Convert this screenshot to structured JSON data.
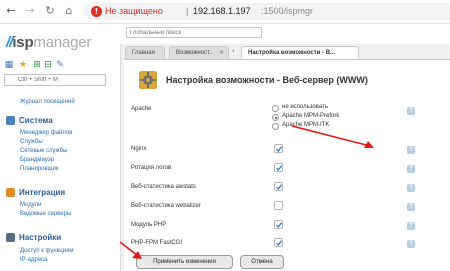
{
  "browser": {
    "insecure_label": "Не защищено",
    "url_separator": "|",
    "url_host": "192.168.1.197",
    "url_path": ":1500/ispmgr"
  },
  "header": {
    "logo_mark": "//",
    "logo_isp": "isp",
    "logo_manager": "manager",
    "global_search_placeholder": "Глобальный поиск"
  },
  "sidebar": {
    "menu_search_placeholder": "Ctrl + Shift + M",
    "top_items": [
      {
        "label": "Журнал посещений"
      }
    ],
    "sections": [
      {
        "title": "Система",
        "items": [
          {
            "label": "Менеджер файлов"
          },
          {
            "label": "Службы"
          },
          {
            "label": "Сетевые службы"
          },
          {
            "label": "Брандмауэр"
          },
          {
            "label": "Планировщик"
          }
        ]
      },
      {
        "title": "Интеграция",
        "items": [
          {
            "label": "Модули"
          },
          {
            "label": "Ведомые серверы"
          }
        ]
      },
      {
        "title": "Настройки",
        "items": [
          {
            "label": "Доступ к функциям"
          },
          {
            "label": "IP-адреса"
          }
        ]
      }
    ]
  },
  "tabs": [
    {
      "label": "Главная"
    },
    {
      "label": "Возможност..",
      "close": "×"
    },
    {
      "label": "Настройка возможности - В..."
    }
  ],
  "panel": {
    "title": "Настройка возможности - Веб-сервер (WWW)",
    "help": "?",
    "apache": {
      "label": "Apache",
      "options": [
        {
          "label": "не использовать",
          "selected": false
        },
        {
          "label": "Apache MPM-Prefork",
          "selected": true
        },
        {
          "label": "Apache MPM-ITK",
          "selected": false
        }
      ]
    },
    "rows": [
      {
        "label": "Nginx",
        "checked": true
      },
      {
        "label": "Ротация логов",
        "checked": true
      },
      {
        "label": "Веб-статистика awstats",
        "checked": true
      },
      {
        "label": "Веб-статистика webalizer",
        "checked": false
      },
      {
        "label": "Модуль PHP",
        "checked": true
      },
      {
        "label": "PHP-FPM FastCGI",
        "checked": true
      }
    ],
    "apply_label": "Применить изменения",
    "cancel_label": "Отмена"
  },
  "colors": {
    "link": "#2a6fb0",
    "section_title": "#2a5f9a",
    "annotation_arrow": "#e01b1b",
    "insecure": "#d93025",
    "check": "#2f7fd0"
  }
}
